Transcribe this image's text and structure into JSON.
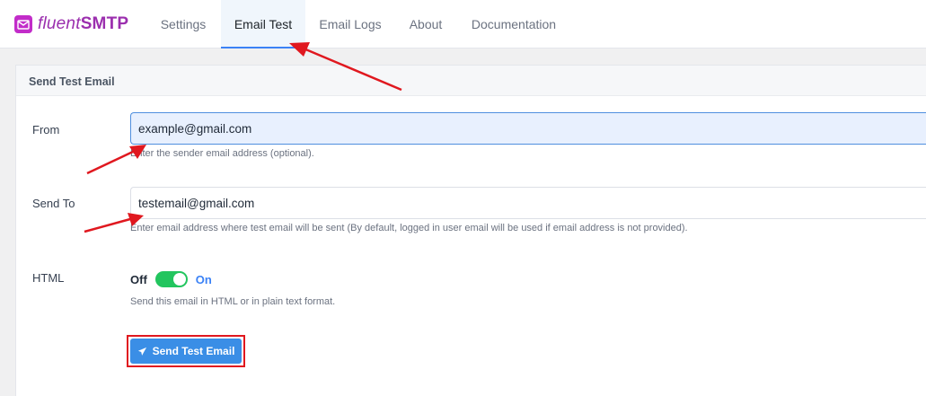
{
  "brand": {
    "name_light": "fluent",
    "name_bold": "SMTP",
    "color": "#9b2fae"
  },
  "nav": {
    "tabs": [
      {
        "label": "Settings",
        "active": false
      },
      {
        "label": "Email Test",
        "active": true
      },
      {
        "label": "Email Logs",
        "active": false
      },
      {
        "label": "About",
        "active": false
      },
      {
        "label": "Documentation",
        "active": false
      }
    ]
  },
  "card": {
    "title": "Send Test Email"
  },
  "form": {
    "from": {
      "label": "From",
      "value": "example@gmail.com",
      "help": "Enter the sender email address (optional)."
    },
    "send_to": {
      "label": "Send To",
      "value": "testemail@gmail.com",
      "help": "Enter email address where test email will be sent (By default, logged in user email will be used if email address is not provided)."
    },
    "html": {
      "label": "HTML",
      "off_label": "Off",
      "on_label": "On",
      "enabled": true,
      "help": "Send this email in HTML or in plain text format."
    },
    "submit": {
      "label": "Send Test Email",
      "icon": "paper-plane-icon"
    }
  },
  "colors": {
    "accent": "#3a8ee6",
    "toggle_on": "#22c55e",
    "annotation": "#e0181f"
  }
}
